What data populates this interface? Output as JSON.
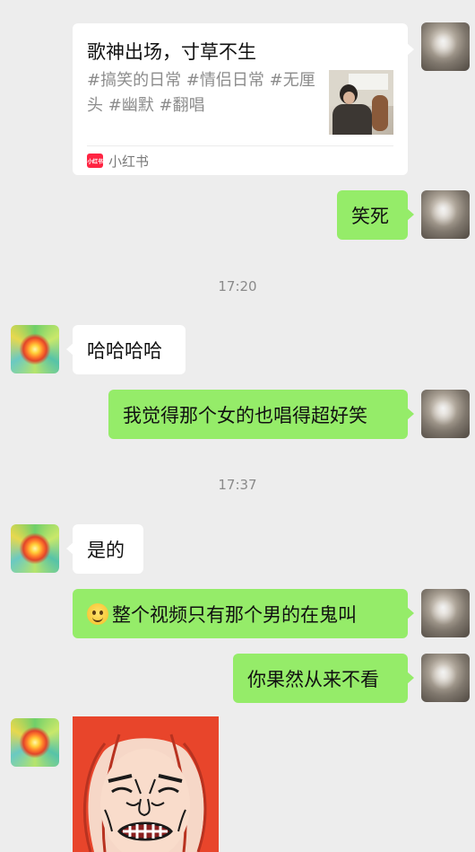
{
  "card": {
    "title": "歌神出场，寸草不生",
    "description": "#搞笑的日常 #情侣日常 #无厘头 #幽默 #翻唱",
    "source_label": "小红书",
    "logo_text": "小红书"
  },
  "messages": [
    {
      "side": "me",
      "text": "笑死"
    },
    {
      "side": "them",
      "text": "哈哈哈哈"
    },
    {
      "side": "me",
      "text": "我觉得那个女的也唱得超好笑"
    },
    {
      "side": "them",
      "text": "是的"
    },
    {
      "side": "me",
      "text": "整个视频只有那个男的在鬼叫",
      "emoji": "slightly-smiling-face-icon"
    },
    {
      "side": "me",
      "text": "你果然从来不看"
    }
  ],
  "timestamps": [
    "17:20",
    "17:37"
  ],
  "colors": {
    "background": "#ededed",
    "my_bubble": "#95ec69",
    "their_bubble": "#ffffff",
    "timestamp_text": "#8a8a8a",
    "brand_red": "#ff2442"
  }
}
